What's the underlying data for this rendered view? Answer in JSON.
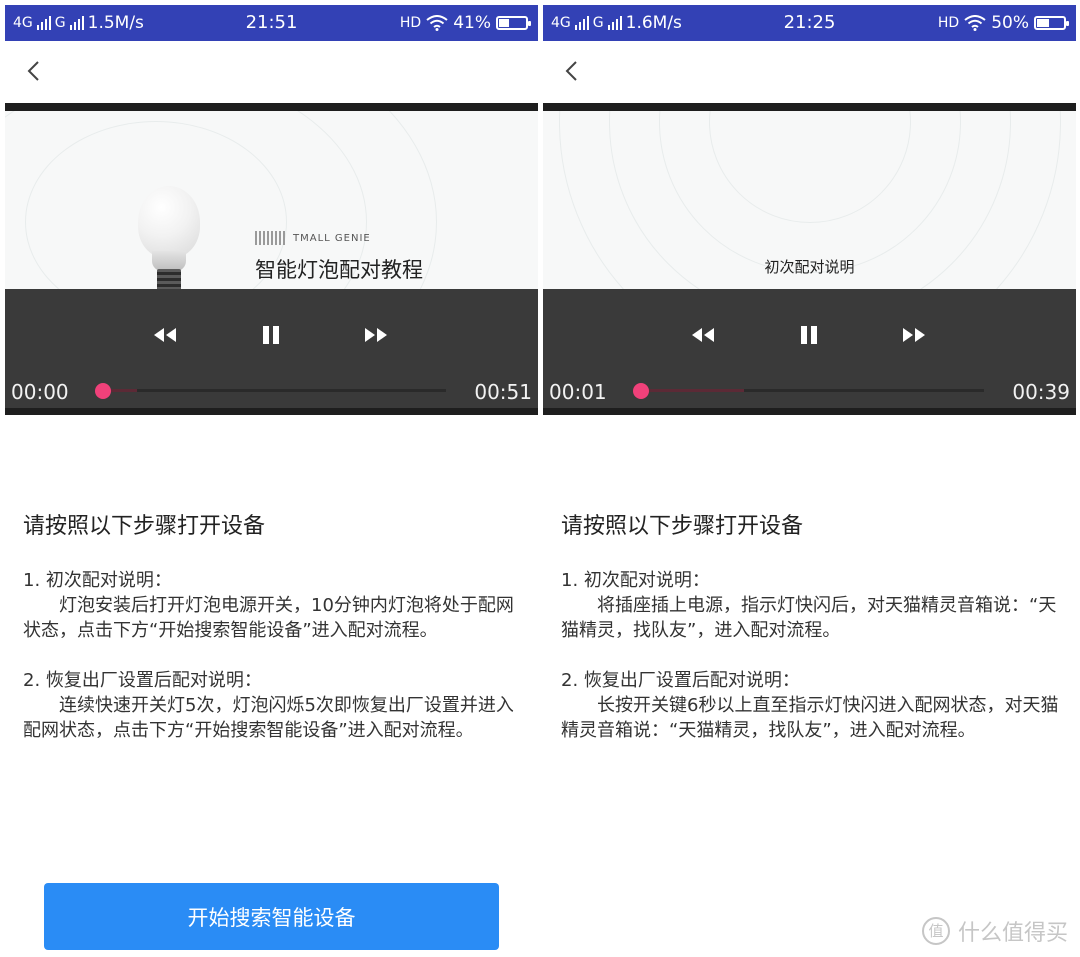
{
  "left_screen": {
    "status": {
      "net": "4G",
      "carrier2": "G",
      "speed": "1.5M/s",
      "time": "21:51",
      "hd": "HD",
      "battery": "41%",
      "battery_level": 0.41
    },
    "video": {
      "brand": "TMALL GENIE",
      "title": "智能灯泡配对教程",
      "current_time": "00:00",
      "duration": "00:51",
      "progress": 0.0,
      "buffered": 0.1
    },
    "heading": "请按照以下步骤打开设备",
    "steps": [
      {
        "title": "1. 初次配对说明：",
        "body": "灯泡安装后打开灯泡电源开关，10分钟内灯泡将处于配网状态，点击下方“开始搜索智能设备”进入配对流程。"
      },
      {
        "title": "2. 恢复出厂设置后配对说明：",
        "body": "连续快速开关灯5次，灯泡闪烁5次即恢复出厂设置并进入配网状态，点击下方“开始搜索智能设备”进入配对流程。"
      }
    ],
    "button_label": "开始搜索智能设备"
  },
  "right_screen": {
    "status": {
      "net": "4G",
      "carrier2": "G",
      "speed": "1.6M/s",
      "time": "21:25",
      "hd": "HD",
      "battery": "50%",
      "battery_level": 0.5
    },
    "video": {
      "title": "初次配对说明",
      "current_time": "00:01",
      "duration": "00:39",
      "progress": 0.0,
      "buffered": 0.3
    },
    "heading": "请按照以下步骤打开设备",
    "steps": [
      {
        "title": "1. 初次配对说明：",
        "body": "将插座插上电源，指示灯快闪后，对天猫精灵音箱说：“天猫精灵，找队友”，进入配对流程。"
      },
      {
        "title": "2. 恢复出厂设置后配对说明：",
        "body": "长按开关键6秒以上直至指示灯快闪进入配网状态，对天猫精灵音箱说：“天猫精灵，找队友”，进入配对流程。"
      }
    ]
  },
  "watermark": {
    "logo_char": "值",
    "text": "什么值得买"
  },
  "colors": {
    "status_bar": "#3341b5",
    "accent_button": "#2a8cf5",
    "progress_knob": "#f0417a"
  },
  "icons": [
    "back-icon",
    "rewind-icon",
    "pause-icon",
    "fast-forward-icon",
    "wifi-icon",
    "battery-icon"
  ]
}
